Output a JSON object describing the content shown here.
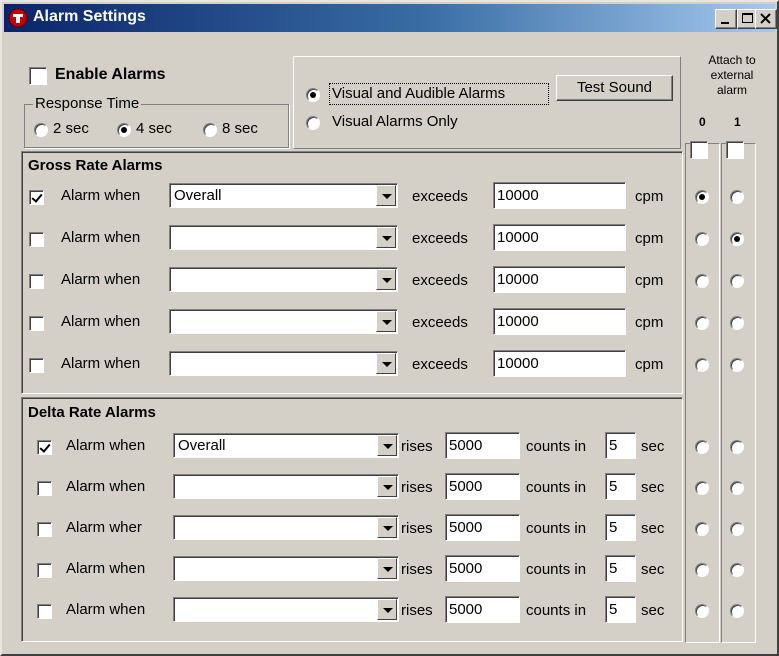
{
  "window": {
    "title": "Alarm Settings"
  },
  "title_buttons": {
    "minimize": "minimize-icon",
    "maximize": "maximize-icon",
    "close": "close-icon"
  },
  "enable": {
    "label": "Enable Alarms",
    "checked": false
  },
  "response_time": {
    "legend": "Response Time",
    "options": [
      {
        "label": "2 sec",
        "selected": false
      },
      {
        "label": "4 sec",
        "selected": true
      },
      {
        "label": "8 sec",
        "selected": false
      }
    ]
  },
  "alarm_type": {
    "options": [
      {
        "label": "Visual and Audible Alarms",
        "selected": true
      },
      {
        "label": "Visual Alarms Only",
        "selected": false
      }
    ],
    "test_sound": "Test Sound"
  },
  "external": {
    "heading_line1": "Attach to",
    "heading_line2": "external",
    "heading_line3": "alarm",
    "col0": "0",
    "col1": "1"
  },
  "gross": {
    "title": "Gross Rate Alarms",
    "rows": [
      {
        "checked": true,
        "label": "Alarm when",
        "source": "Overall",
        "exceeds": "exceeds",
        "value": "10000",
        "unit": "cpm",
        "ext": 0
      },
      {
        "checked": false,
        "label": "Alarm when",
        "source": "",
        "exceeds": "exceeds",
        "value": "10000",
        "unit": "cpm",
        "ext": 1
      },
      {
        "checked": false,
        "label": "Alarm when",
        "source": "",
        "exceeds": "exceeds",
        "value": "10000",
        "unit": "cpm",
        "ext": -1
      },
      {
        "checked": false,
        "label": "Alarm when",
        "source": "",
        "exceeds": "exceeds",
        "value": "10000",
        "unit": "cpm",
        "ext": -1
      },
      {
        "checked": false,
        "label": "Alarm when",
        "source": "",
        "exceeds": "exceeds",
        "value": "10000",
        "unit": "cpm",
        "ext": -1
      }
    ]
  },
  "delta": {
    "title": "Delta Rate Alarms",
    "rows": [
      {
        "checked": true,
        "label": "Alarm when",
        "source": "Overall",
        "rises": "rises",
        "value": "5000",
        "counts_in": "counts in",
        "secs": "5",
        "unit": "sec",
        "ext": -1
      },
      {
        "checked": false,
        "label": "Alarm when",
        "source": "",
        "rises": "rises",
        "value": "5000",
        "counts_in": "counts in",
        "secs": "5",
        "unit": "sec",
        "ext": -1
      },
      {
        "checked": false,
        "label": "Alarm wher",
        "source": "",
        "rises": "rises",
        "value": "5000",
        "counts_in": "counts in",
        "secs": "5",
        "unit": "sec",
        "ext": -1
      },
      {
        "checked": false,
        "label": "Alarm when",
        "source": "",
        "rises": "rises",
        "value": "5000",
        "counts_in": "counts in",
        "secs": "5",
        "unit": "sec",
        "ext": -1
      },
      {
        "checked": false,
        "label": "Alarm when",
        "source": "",
        "rises": "rises",
        "value": "5000",
        "counts_in": "counts in",
        "secs": "5",
        "unit": "sec",
        "ext": -1
      }
    ]
  },
  "colors": {
    "title_start": "#0a246a",
    "title_end": "#a6caf0",
    "face": "#d4d0c8",
    "app_icon": "#c00000"
  }
}
